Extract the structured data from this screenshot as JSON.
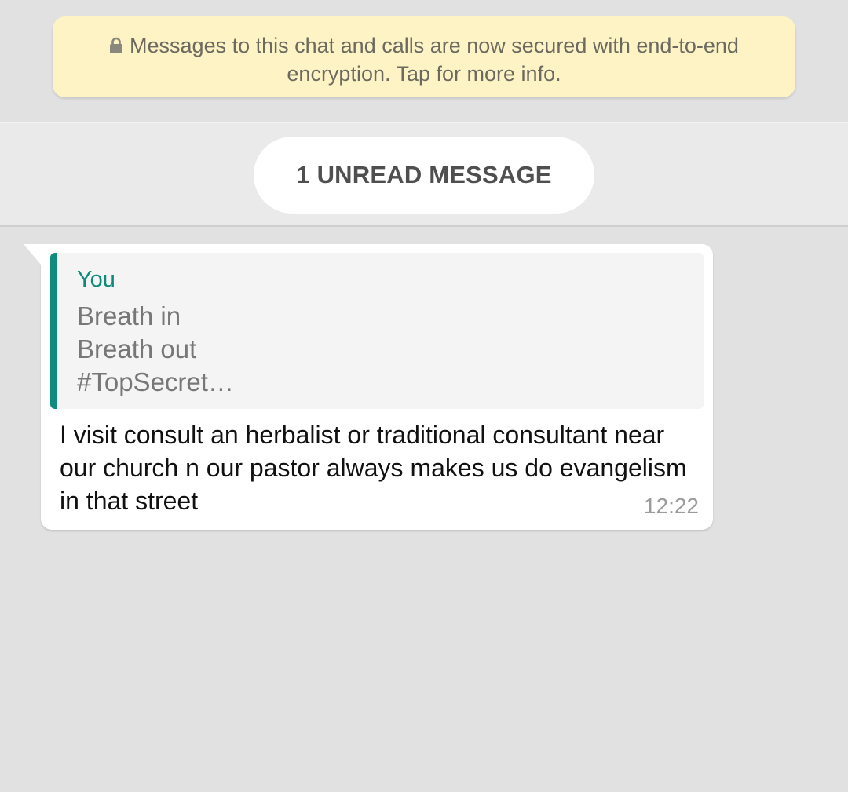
{
  "encryption_notice": {
    "text": "Messages to this chat and calls are now secured with end-to-end encryption. Tap for more info.",
    "icon": "lock-icon"
  },
  "unread_divider": {
    "label": "1 UNREAD MESSAGE"
  },
  "message": {
    "quoted": {
      "author": "You",
      "lines": [
        "Breath in",
        "Breath out",
        "#TopSecret…"
      ]
    },
    "text": "I visit consult an herbalist or traditional consultant near our church n our pastor always makes us do evangelism in that street",
    "time": "12:22"
  },
  "colors": {
    "background": "#e1e1e1",
    "banner": "#fdf3c5",
    "accent": "#0f8c7e",
    "bubble": "#ffffff"
  }
}
